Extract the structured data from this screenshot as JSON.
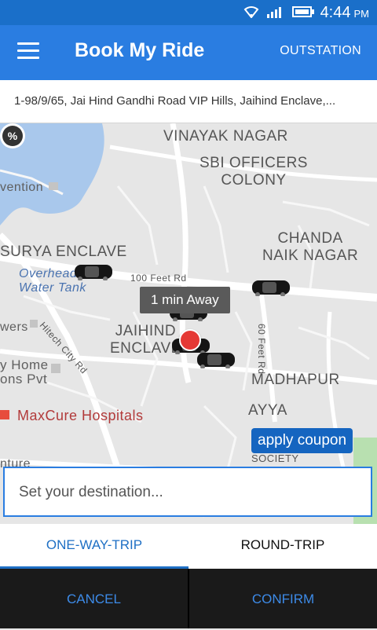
{
  "status_bar": {
    "time": "4:44",
    "ampm": "PM"
  },
  "app_bar": {
    "title": "Book My Ride",
    "outstation_label": "OUTSTATION"
  },
  "pickup": {
    "address": "1-98/9/65, Jai Hind Gandhi Road VIP Hills, Jaihind Enclave,..."
  },
  "map": {
    "labels": {
      "vinayak": "VINAYAK NAGAR",
      "sbi": "SBI OFFICERS\nCOLONY",
      "chanda": "CHANDA\nNAIK NAGAR",
      "surya": "SURYA ENCLAVE",
      "overhead": "Overhead\nWater Tank",
      "road_100ft": "100 Feet Rd",
      "road_hitech": "Hitech City Rd",
      "road_60ft": "60 Feet Rd",
      "jaihind": "JAIHIND\nENCLAVE",
      "madhapur": "MADHAPUR",
      "ayya": "AYYA",
      "society": "SOCIETY",
      "convention": "vention",
      "wers": "wers",
      "yhome": "y Home",
      "ons": "ons Pvt",
      "maxcure": "MaxCure Hospitals",
      "nture": "nture"
    },
    "eta_label": "1 min Away"
  },
  "coupon": {
    "label": "apply coupon",
    "icon": "discount-badge-icon"
  },
  "destination": {
    "placeholder": "Set your destination...",
    "value": ""
  },
  "tabs": [
    {
      "label": "ONE-WAY-TRIP",
      "selected": true
    },
    {
      "label": "ROUND-TRIP",
      "selected": false
    }
  ],
  "actions": {
    "cancel_label": "CANCEL",
    "confirm_label": "CONFIRM"
  },
  "colors": {
    "primary": "#2a7de1",
    "status_bar": "#1a6fc9",
    "coupon_button": "#1565c0",
    "pin": "#e53935",
    "action_text": "#3d8be8"
  }
}
